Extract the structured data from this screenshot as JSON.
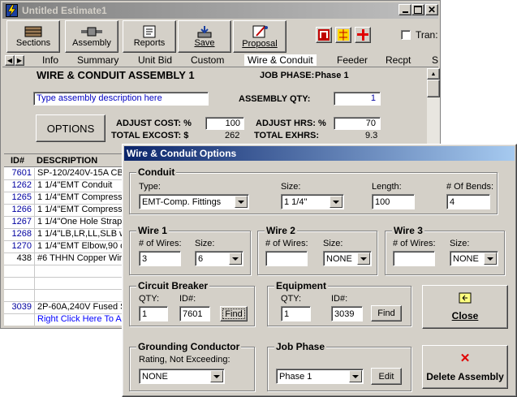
{
  "main_window": {
    "title": "Untitled Estimate1",
    "toolbar": {
      "sections": "Sections",
      "assembly": "Assembly",
      "reports": "Reports",
      "save": "Save",
      "proposal": "Proposal",
      "trans_label": "Tran:"
    },
    "tabs": [
      "Info",
      "Summary",
      "Unit Bid",
      "Custom",
      "Wire & Conduit",
      "Feeder",
      "Recpt",
      "S"
    ],
    "active_tab": "Wire & Conduit",
    "header": {
      "title": "WIRE & CONDUIT ASSEMBLY 1",
      "job_phase_label": "JOB PHASE:",
      "job_phase_value": "Phase 1",
      "description_placeholder": "Type assembly description here",
      "assembly_qty_label": "ASSEMBLY QTY:",
      "assembly_qty_value": "1",
      "options_button": "OPTIONS",
      "adjust_cost_label": "ADJUST COST:  %",
      "adjust_cost_value": "100",
      "adjust_hrs_label": "ADJUST HRS:  %",
      "adjust_hrs_value": "70",
      "total_excost_label": "TOTAL EXCOST: $",
      "total_excost_value": "262",
      "total_exhrs_label": "TOTAL EXHRS:",
      "total_exhrs_value": "9.3"
    },
    "table": {
      "columns": [
        "ID#",
        "DESCRIPTION"
      ],
      "rows": [
        {
          "id": "7601",
          "desc": "SP-120/240V-15A CB"
        },
        {
          "id": "1262",
          "desc": "1 1/4\"EMT Conduit"
        },
        {
          "id": "1265",
          "desc": "1 1/4\"EMT Compressic"
        },
        {
          "id": "1266",
          "desc": "1 1/4\"EMT Compressic"
        },
        {
          "id": "1267",
          "desc": "1 1/4\"One Hole Strap,S"
        },
        {
          "id": "1268",
          "desc": "1 1/4\"LB,LR,LL,SLB w"
        },
        {
          "id": "1270",
          "desc": "1 1/4\"EMT Elbow,90 o"
        },
        {
          "id": "438",
          "desc": "#6 THHN Copper Wire"
        },
        {
          "id": "",
          "desc": ""
        },
        {
          "id": "",
          "desc": ""
        },
        {
          "id": "",
          "desc": ""
        },
        {
          "id": "3039",
          "desc": "2P-60A,240V Fused S"
        }
      ],
      "footer_link": "Right Click Here To Ac"
    }
  },
  "dialog": {
    "title": "Wire & Conduit Options",
    "conduit": {
      "group": "Conduit",
      "type_label": "Type:",
      "type_value": "EMT-Comp. Fittings",
      "size_label": "Size:",
      "size_value": "1 1/4\"",
      "length_label": "Length:",
      "length_value": "100",
      "bends_label": "# Of Bends:",
      "bends_value": "4"
    },
    "wire1": {
      "group": "Wire 1",
      "num_label": "# of Wires:",
      "num_value": "3",
      "size_label": "Size:",
      "size_value": "6"
    },
    "wire2": {
      "group": "Wire 2",
      "num_label": "# of Wires:",
      "num_value": "",
      "size_label": "Size:",
      "size_value": "NONE"
    },
    "wire3": {
      "group": "Wire 3",
      "num_label": "# of Wires:",
      "num_value": "",
      "size_label": "Size:",
      "size_value": "NONE"
    },
    "breaker": {
      "group": "Circuit Breaker",
      "qty_label": "QTY:",
      "qty_value": "1",
      "id_label": "ID#:",
      "id_value": "7601",
      "find": "Find"
    },
    "equipment": {
      "group": "Equipment",
      "qty_label": "QTY:",
      "qty_value": "1",
      "id_label": "ID#:",
      "id_value": "3039",
      "find": "Find"
    },
    "grounding": {
      "group": "Grounding Conductor",
      "rating_label": "Rating, Not Exceeding:",
      "rating_value": "NONE"
    },
    "job_phase": {
      "group": "Job Phase",
      "value": "Phase 1",
      "edit": "Edit"
    },
    "close_button": "Close",
    "delete_button": "Delete Assembly"
  },
  "colors": {
    "titlebar_active": "#0a246a",
    "titlebar_active_end": "#a6caf0",
    "titlebar_inactive": "#808080",
    "face": "#d4d0c8",
    "id_blue": "#0000a0",
    "link_blue": "#0000ff"
  }
}
